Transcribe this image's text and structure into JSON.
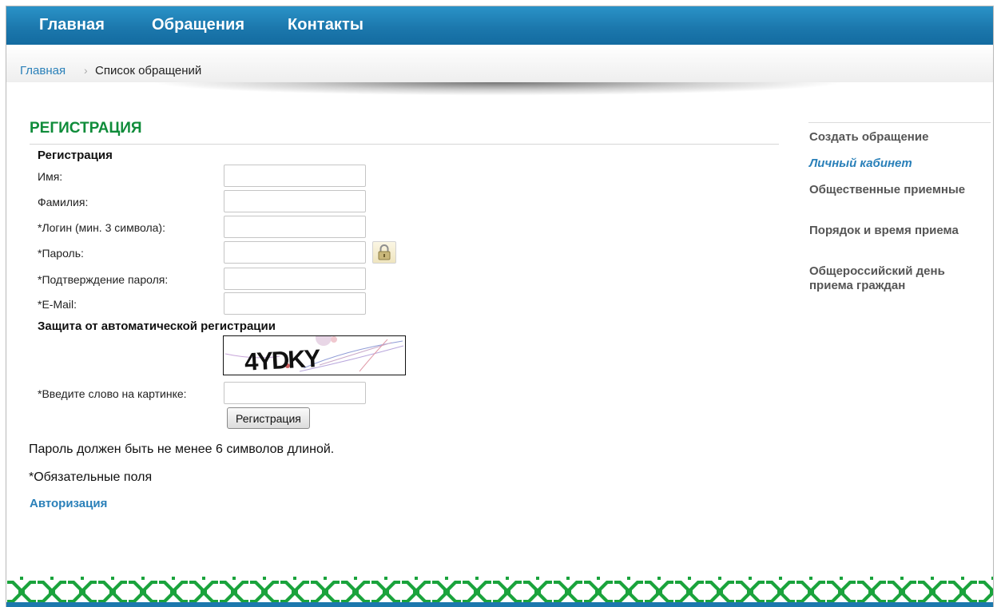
{
  "nav": {
    "home": "Главная",
    "appeals": "Обращения",
    "contacts": "Контакты"
  },
  "breadcrumb": {
    "home": "Главная",
    "separator": "›",
    "current": "Список обращений"
  },
  "page": {
    "heading": "РЕГИСТРАЦИЯ",
    "subheading": "Регистрация"
  },
  "form": {
    "first_name_label": "Имя:",
    "last_name_label": "Фамилия:",
    "login_label": "*Логин (мин. 3 символа):",
    "password_label": "*Пароль:",
    "confirm_label": "*Подтверждение пароля:",
    "email_label": "*E-Mail:",
    "captcha_heading": "Защита от автоматической регистрации",
    "captcha_word": "4YDKY",
    "captcha_label": "*Введите слово на картинке:",
    "submit_label": "Регистрация",
    "first_name_value": "",
    "last_name_value": "",
    "login_value": "",
    "password_value": "",
    "confirm_value": "",
    "email_value": "",
    "captcha_value": ""
  },
  "notes": {
    "password_rule": "Пароль должен быть не менее 6 символов длиной.",
    "required": "*Обязательные поля",
    "auth_link": "Авторизация"
  },
  "sidebar": {
    "items": [
      {
        "label": "Создать обращение",
        "active": false
      },
      {
        "label": "Личный кабинет",
        "active": true
      },
      {
        "label": "Общественные приемные",
        "active": false
      },
      {
        "label": "Порядок и время приема",
        "active": false
      },
      {
        "label": "Общероссийский день приема граждан",
        "active": false
      }
    ]
  },
  "icons": {
    "password_toggle": "lock-icon"
  },
  "colors": {
    "nav_bar": "#1c78ad",
    "heading": "#0f8c3a",
    "link": "#2a80b9",
    "ornament": "#1aa33c"
  }
}
